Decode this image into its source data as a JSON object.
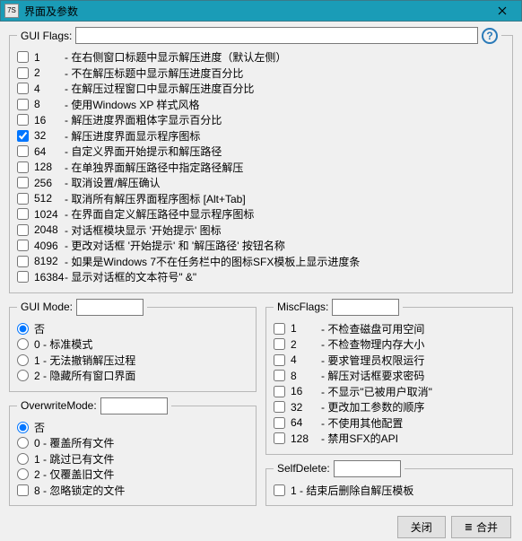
{
  "title": "界面及参数",
  "icon_text": "7S",
  "gui_flags": {
    "label": "GUI Flags:",
    "value": "",
    "items": [
      {
        "num": "1",
        "text": "- 在右侧窗口标题中显示解压进度（默认左侧）"
      },
      {
        "num": "2",
        "text": "- 不在解压标题中显示解压进度百分比"
      },
      {
        "num": "4",
        "text": "- 在解压过程窗口中显示解压进度百分比"
      },
      {
        "num": "8",
        "text": "- 使用Windows XP 样式风格"
      },
      {
        "num": "16",
        "text": "- 解压进度界面粗体字显示百分比"
      },
      {
        "num": "32",
        "text": "- 解压进度界面显示程序图标",
        "checked": true
      },
      {
        "num": "64",
        "text": "- 自定义界面开始提示和解压路径"
      },
      {
        "num": "128",
        "text": "- 在单独界面解压路径中指定路径解压"
      },
      {
        "num": "256",
        "text": "- 取消设置/解压确认"
      },
      {
        "num": "512",
        "text": "- 取消所有解压界面程序图标 [Alt+Tab]"
      },
      {
        "num": "1024",
        "text": "- 在界面自定义解压路径中显示程序图标"
      },
      {
        "num": "2048",
        "text": "- 对话框模块显示 '开始提示' 图标"
      },
      {
        "num": "4096",
        "text": "- 更改对话框 '开始提示' 和 '解压路径' 按钮名称"
      },
      {
        "num": "8192",
        "text": "- 如果是Windows 7不在任务栏中的图标SFX模板上显示进度条"
      },
      {
        "num": "16384",
        "text": "- 显示对话框的文本符号\" &\""
      }
    ]
  },
  "gui_mode": {
    "label": "GUI Mode:",
    "value": "",
    "items": [
      {
        "text": "否",
        "checked": true
      },
      {
        "text": "0 - 标准模式"
      },
      {
        "text": "1 - 无法撤销解压过程"
      },
      {
        "text": "2 - 隐藏所有窗口界面"
      }
    ]
  },
  "overwrite_mode": {
    "label": "OverwriteMode:",
    "value": "",
    "items": [
      {
        "text": "否",
        "checked": true
      },
      {
        "text": "0 - 覆盖所有文件"
      },
      {
        "text": "1 - 跳过已有文件"
      },
      {
        "text": "2 - 仅覆盖旧文件"
      },
      {
        "text": "8 - 忽略锁定的文件",
        "type": "checkbox"
      }
    ]
  },
  "misc_flags": {
    "label": "MiscFlags:",
    "value": "",
    "items": [
      {
        "num": "1",
        "text": "- 不检查磁盘可用空间"
      },
      {
        "num": "2",
        "text": "- 不检查物理内存大小"
      },
      {
        "num": "4",
        "text": "- 要求管理员权限运行"
      },
      {
        "num": "8",
        "text": "- 解压对话框要求密码"
      },
      {
        "num": "16",
        "text": "- 不显示\"已被用户取消\""
      },
      {
        "num": "32",
        "text": "- 更改加工参数的顺序"
      },
      {
        "num": "64",
        "text": "- 不使用其他配置"
      },
      {
        "num": "128",
        "text": "- 禁用SFX的API"
      }
    ]
  },
  "self_delete": {
    "label": "SelfDelete:",
    "value": "",
    "items": [
      {
        "text": "1 - 结束后删除自解压模板"
      }
    ]
  },
  "buttons": {
    "close": "关闭",
    "merge": "合并"
  }
}
